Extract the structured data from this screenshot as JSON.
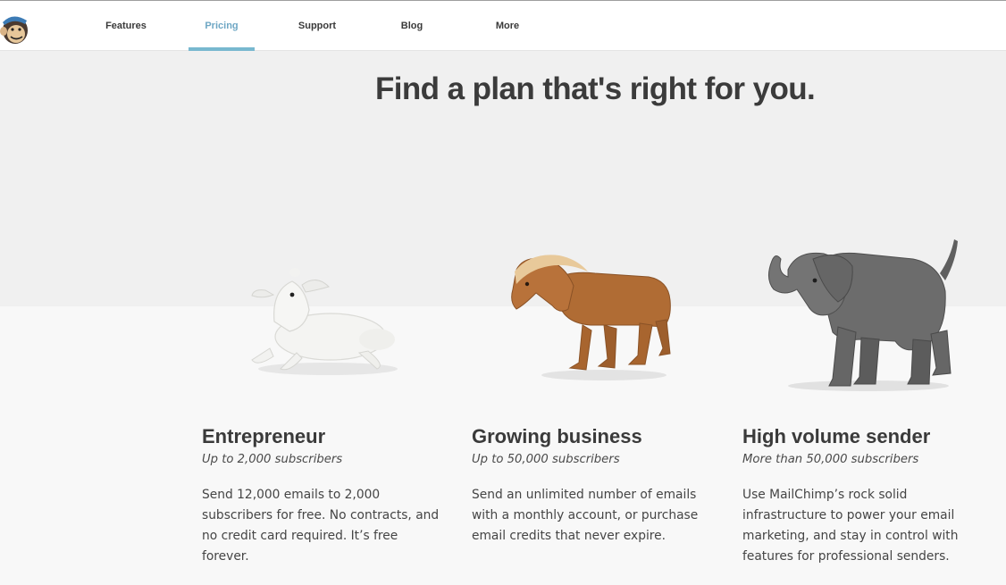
{
  "nav": {
    "items": [
      {
        "label": "Features",
        "active": false
      },
      {
        "label": "Pricing",
        "active": true
      },
      {
        "label": "Support",
        "active": false
      },
      {
        "label": "Blog",
        "active": false
      },
      {
        "label": "More",
        "active": false
      }
    ],
    "active_color": "#6ea7c4"
  },
  "hero": {
    "title": "Find a plan that's right for you."
  },
  "plans": [
    {
      "image": "lamb-figurine",
      "title": "Entrepreneur",
      "subtitle": "Up to 2,000 subscribers",
      "description": "Send 12,000 emails to 2,000 subscribers for free. No contracts, and no credit card required. It’s free forever."
    },
    {
      "image": "horse-figurine",
      "title": "Growing business",
      "subtitle": "Up to 50,000 subscribers",
      "description": "Send an unlimited number of emails with a monthly account, or purchase email credits that never expire."
    },
    {
      "image": "elephant-figurine",
      "title": "High volume sender",
      "subtitle": "More than 50,000 subscribers",
      "description": "Use MailChimp’s rock solid infrastructure to power your email marketing, and stay in control with features for professional senders."
    }
  ]
}
